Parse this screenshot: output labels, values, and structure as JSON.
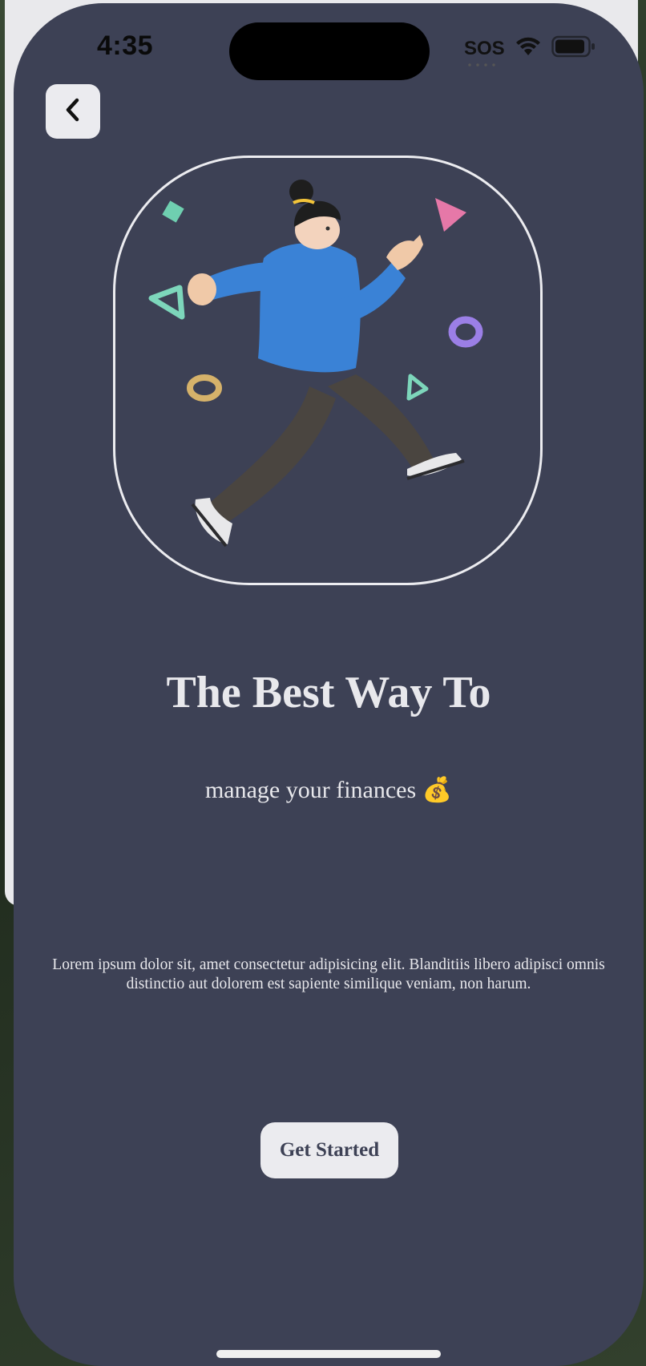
{
  "status_bar": {
    "time": "4:35",
    "sos": "SOS",
    "signal_icon": "wifi-icon",
    "battery_icon": "battery-icon"
  },
  "navigation": {
    "back_icon": "chevron-left-icon"
  },
  "hero": {
    "illustration": "walking-person-illustration",
    "border_color": "#ececf0"
  },
  "content": {
    "title": "The Best Way To",
    "subtitle": "manage your finances 💰",
    "body": "Lorem ipsum dolor sit, amet consectetur adipisicing elit. Blanditiis libero adipisci omnis distinctio aut dolorem est sapiente similique veniam, non harum.",
    "cta_label": "Get Started"
  },
  "colors": {
    "background": "#3d4155",
    "text": "#e8e8ec",
    "button_bg": "#ebebef",
    "button_text": "#3d4155"
  }
}
